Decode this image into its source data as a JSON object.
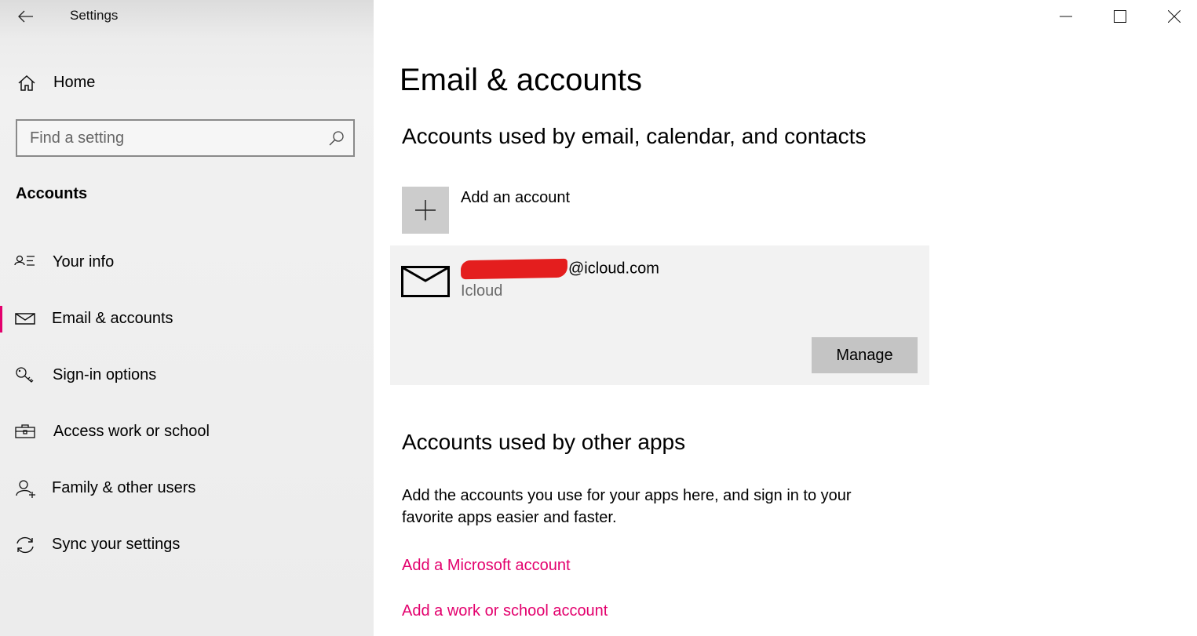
{
  "window": {
    "title": "Settings",
    "controls": {
      "minimize_icon": "minimize-icon",
      "maximize_icon": "maximize-icon",
      "close_icon": "close-icon"
    }
  },
  "sidebar": {
    "back_icon": "back-arrow-icon",
    "home": {
      "label": "Home",
      "icon": "home-icon"
    },
    "search": {
      "placeholder": "Find a setting",
      "value": "",
      "icon": "search-icon"
    },
    "section_label": "Accounts",
    "items": [
      {
        "label": "Your info",
        "icon": "person-list-icon",
        "selected": false
      },
      {
        "label": "Email & accounts",
        "icon": "mail-icon",
        "selected": true
      },
      {
        "label": "Sign-in options",
        "icon": "key-icon",
        "selected": false
      },
      {
        "label": "Access work or school",
        "icon": "briefcase-icon",
        "selected": false
      },
      {
        "label": "Family & other users",
        "icon": "add-person-icon",
        "selected": false
      },
      {
        "label": "Sync your settings",
        "icon": "sync-icon",
        "selected": false
      }
    ],
    "accent_color": "#e3006d"
  },
  "main": {
    "title": "Email & accounts",
    "email_section": {
      "heading": "Accounts used by email, calendar, and contacts",
      "add_account_label": "Add an account",
      "accounts": [
        {
          "email_visible_suffix": "@icloud.com",
          "email_redacted": true,
          "provider": "Icloud",
          "manage_label": "Manage"
        }
      ]
    },
    "other_apps_section": {
      "heading": "Accounts used by other apps",
      "description": "Add the accounts you use for your apps here, and sign in to your favorite apps easier and faster.",
      "links": [
        {
          "label": "Add a Microsoft account"
        },
        {
          "label": "Add a work or school account"
        }
      ]
    },
    "link_color": "#e3006d"
  }
}
